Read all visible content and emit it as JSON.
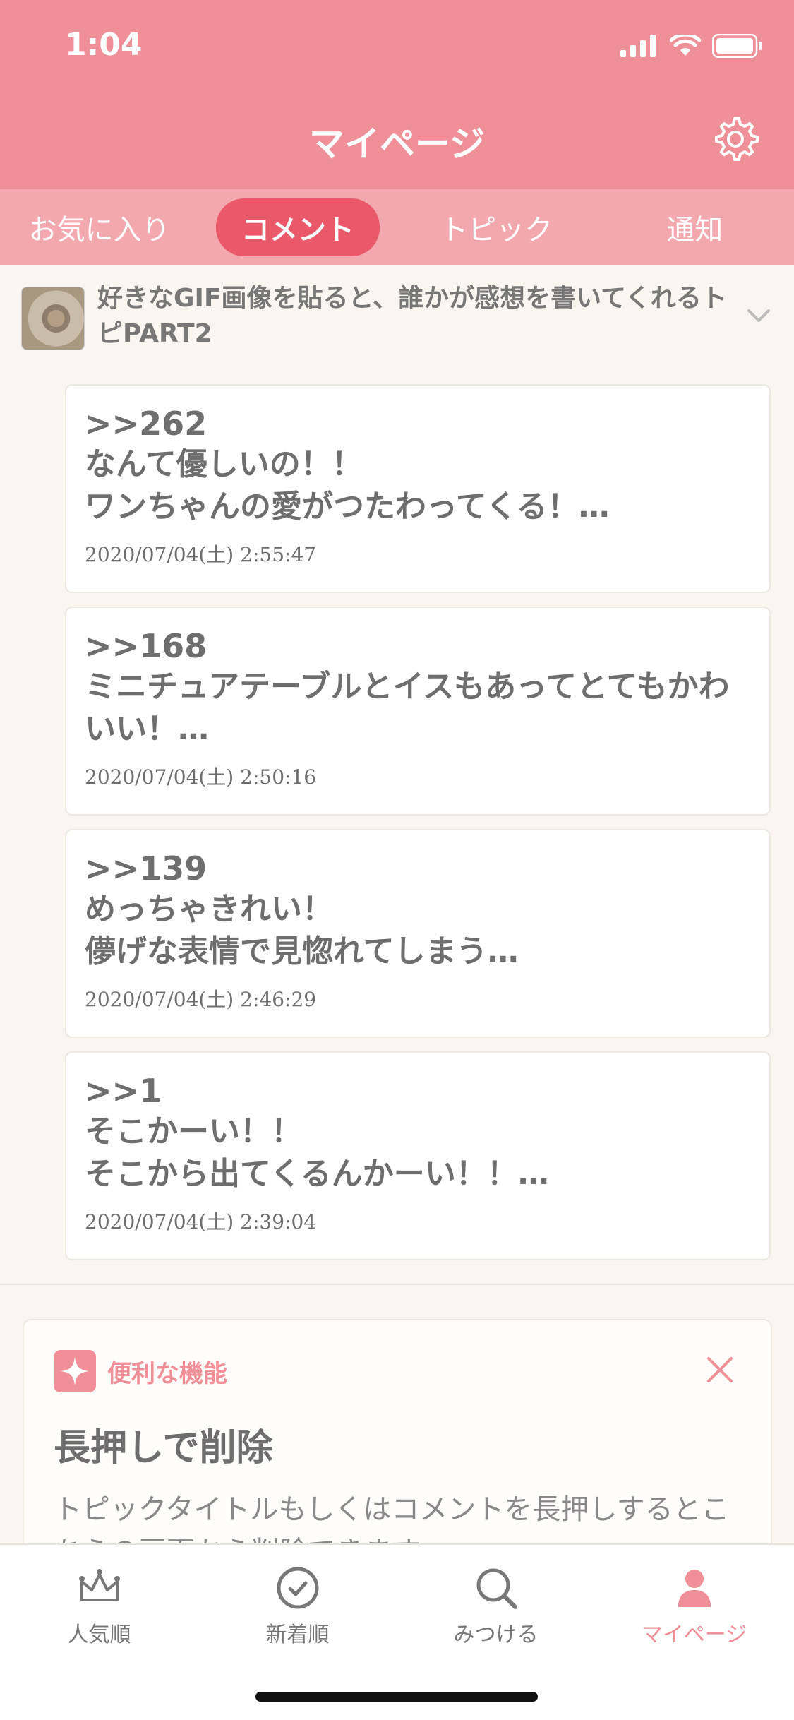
{
  "status": {
    "time": "1:04"
  },
  "header": {
    "title": "マイページ"
  },
  "tabs": [
    {
      "label": "お気に入り"
    },
    {
      "label": "コメント"
    },
    {
      "label": "トピック"
    },
    {
      "label": "通知"
    }
  ],
  "active_tab": "コメント",
  "topic": {
    "title": "好きなGIF画像を貼ると、誰かが感想を書いてくれるトピPART2"
  },
  "comments": [
    {
      "ref": ">>262",
      "text": "なんて優しいの！！\nワンちゃんの愛がつたわってくる！…",
      "date": "2020/07/04(土) 2:55:47"
    },
    {
      "ref": ">>168",
      "text": "ミニチュアテーブルとイスもあってとてもかわいい！…",
      "date": "2020/07/04(土) 2:50:16"
    },
    {
      "ref": ">>139",
      "text": "めっちゃきれい！\n儚げな表情で見惚れてしまう…",
      "date": "2020/07/04(土) 2:46:29"
    },
    {
      "ref": ">>1",
      "text": "そこかーい！！\nそこから出てくるんかーい！！…",
      "date": "2020/07/04(土) 2:39:04"
    }
  ],
  "tip": {
    "label": "便利な機能",
    "heading": "長押しで削除",
    "body": "トピックタイトルもしくはコメントを長押しするとこちらの画面から削除できます。"
  },
  "nav": [
    {
      "label": "人気順",
      "icon": "crown-icon"
    },
    {
      "label": "新着順",
      "icon": "clock-icon"
    },
    {
      "label": "みつける",
      "icon": "search-icon"
    },
    {
      "label": "マイページ",
      "icon": "person-icon"
    }
  ],
  "colors": {
    "accent": "#ef8f98",
    "active_tab": "#e9596a"
  }
}
